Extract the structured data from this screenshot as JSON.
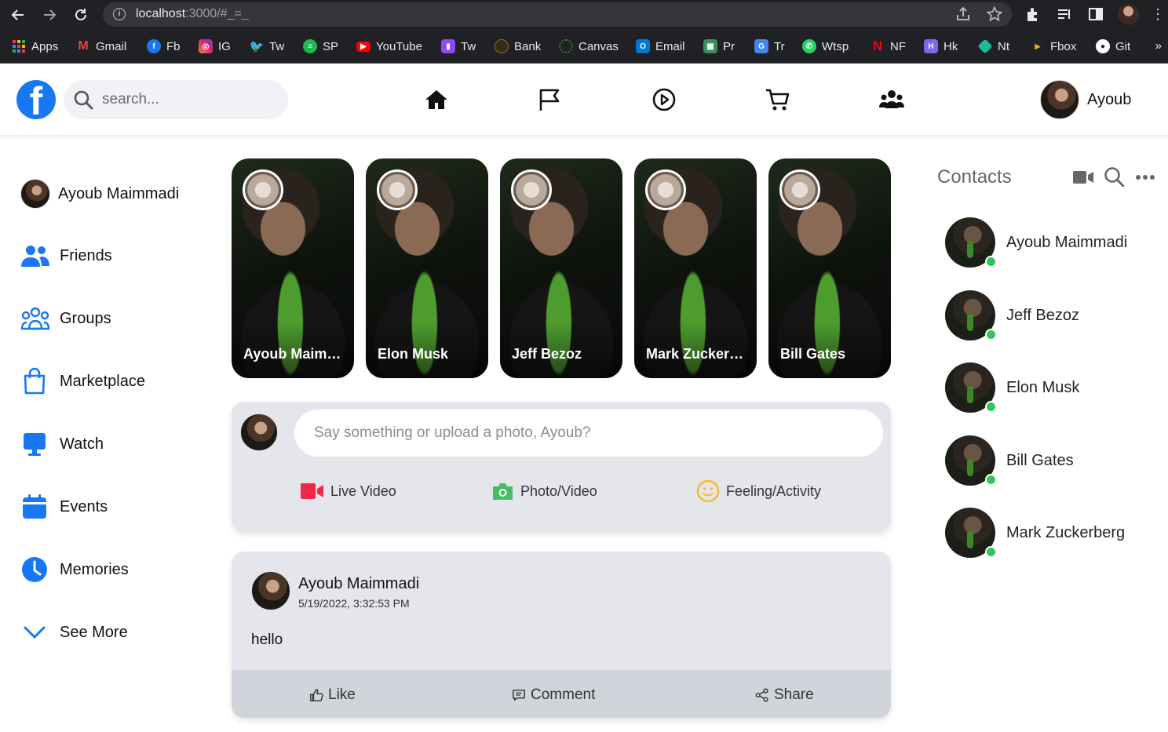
{
  "browser": {
    "url_host": "localhost",
    "url_rest": ":3000/#_=_",
    "bookmarks": [
      {
        "label": "Apps",
        "color": "#ea4335"
      },
      {
        "label": "Gmail",
        "color": "#ea4335"
      },
      {
        "label": "Fb",
        "color": "#1877f2"
      },
      {
        "label": "IG",
        "color": "#e1306c"
      },
      {
        "label": "Tw",
        "color": "#1da1f2"
      },
      {
        "label": "SP",
        "color": "#1db954"
      },
      {
        "label": "YouTube",
        "color": "#ff0000"
      },
      {
        "label": "Tw",
        "color": "#9146ff"
      },
      {
        "label": "Bank",
        "color": "#6b4a2a"
      },
      {
        "label": "Canvas",
        "color": "#2e7d32"
      },
      {
        "label": "Email",
        "color": "#0078d4"
      },
      {
        "label": "Pr",
        "color": "#3c8d5a"
      },
      {
        "label": "Tr",
        "color": "#4285f4"
      },
      {
        "label": "Wtsp",
        "color": "#25d366"
      },
      {
        "label": "NF",
        "color": "#e50914"
      },
      {
        "label": "Hk",
        "color": "#7b68ee"
      },
      {
        "label": "Nt",
        "color": "#1abc9c"
      },
      {
        "label": "Fbox",
        "color": "#f4b400"
      },
      {
        "label": "Git",
        "color": "#ffffff"
      }
    ],
    "more": "»"
  },
  "header": {
    "logo": "f",
    "search_placeholder": "search...",
    "user_name": "Ayoub"
  },
  "sidebar": {
    "user_name": "Ayoub Maimmadi",
    "items": [
      {
        "label": "Friends",
        "icon": "friends-icon"
      },
      {
        "label": "Groups",
        "icon": "groups-icon"
      },
      {
        "label": "Marketplace",
        "icon": "shopping-bag-icon"
      },
      {
        "label": "Watch",
        "icon": "monitor-icon"
      },
      {
        "label": "Events",
        "icon": "calendar-icon"
      },
      {
        "label": "Memories",
        "icon": "clock-icon"
      },
      {
        "label": "See More",
        "icon": "chevron-down-icon"
      }
    ]
  },
  "stories": [
    {
      "name": "Ayoub Maimmadi"
    },
    {
      "name": "Elon Musk"
    },
    {
      "name": "Jeff Bezoz"
    },
    {
      "name": "Mark Zuckerberg"
    },
    {
      "name": "Bill Gates"
    }
  ],
  "composer": {
    "placeholder": "Say something or upload a photo, Ayoub?",
    "live_video": "Live Video",
    "photo_video": "Photo/Video",
    "feeling": "Feeling/Activity",
    "colors": {
      "live": "#f02849",
      "photo": "#45bd62",
      "feeling": "#f7b928"
    }
  },
  "post": {
    "author": "Ayoub Maimmadi",
    "date": "5/19/2022, 3:32:53 PM",
    "text": "hello",
    "like": "Like",
    "comment": "Comment",
    "share": "Share"
  },
  "contacts": {
    "title": "Contacts",
    "list": [
      {
        "name": "Ayoub Maimmadi"
      },
      {
        "name": "Jeff Bezoz"
      },
      {
        "name": "Elon Musk"
      },
      {
        "name": "Bill Gates"
      },
      {
        "name": "Mark Zuckerberg"
      }
    ]
  },
  "colors": {
    "brand": "#1877f2",
    "online": "#31c55e"
  }
}
